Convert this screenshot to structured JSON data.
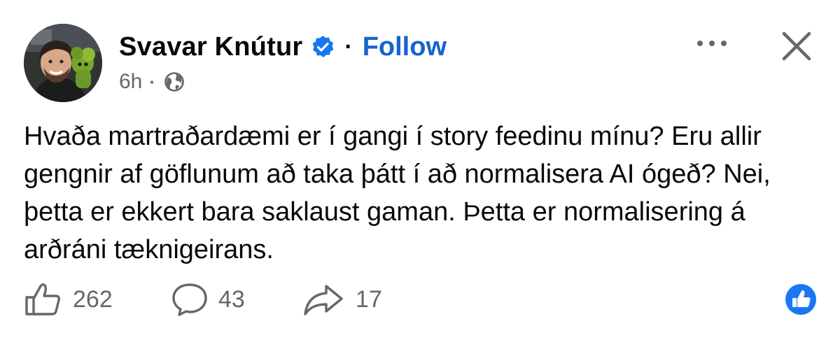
{
  "author": {
    "name": "Svavar Knútur",
    "verified_icon": "verified-badge-icon",
    "follow_label": "Follow",
    "separator": "·"
  },
  "meta": {
    "time": "6h",
    "separator": "·",
    "audience_icon": "globe-icon"
  },
  "header_actions": {
    "more_icon": "more-options-icon",
    "close_icon": "close-icon"
  },
  "post": {
    "text": "Hvaða martraðardæmi er í gangi í story feedinu mínu? Eru allir gengnir af göflunum að taka þátt í að normalisera AI ógeð? Nei, þetta er ekkert bara saklaust gaman. Þetta er normalisering á arðráni tæknigeirans."
  },
  "actions": {
    "likes": "262",
    "comments": "43",
    "shares": "17"
  },
  "colors": {
    "accent": "#1763cf",
    "text": "#080809",
    "muted": "#65676b",
    "reaction_blue": "#1877f2"
  }
}
